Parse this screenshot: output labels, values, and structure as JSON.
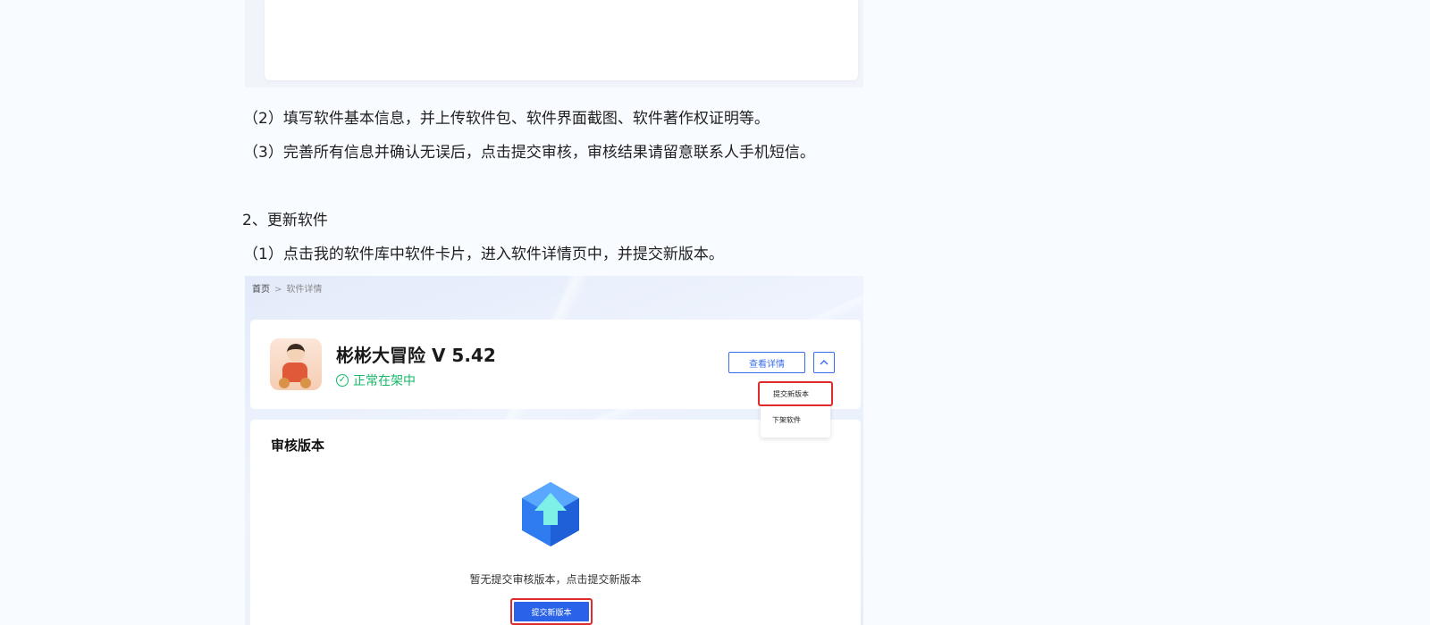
{
  "doc": {
    "step2_line": "（2）填写软件基本信息，并上传软件包、软件界面截图、软件著作权证明等。",
    "step3_line": "（3）完善所有信息并确认无误后，点击提交审核，审核结果请留意联系人手机短信。",
    "section2_heading": "2、更新软件",
    "update_step1_line": "（1）点击我的软件库中软件卡片，进入软件详情页中，并提交新版本。"
  },
  "screenshot": {
    "breadcrumb": {
      "home": "首页",
      "separator": ">",
      "current": "软件详情"
    },
    "app": {
      "name": "彬彬大冒险 V 5.42",
      "status": "正常在架中",
      "status_color": "#14b866"
    },
    "buttons": {
      "view_details": "查看详情",
      "toggle_icon": "chevron-up-icon"
    },
    "dropdown": {
      "items": [
        "提交新版本",
        "下架软件"
      ]
    },
    "audit": {
      "title": "审核版本",
      "empty_text": "暂无提交审核版本，点击提交新版本",
      "submit_button": "提交新版本"
    },
    "colors": {
      "accent": "#2b63e8",
      "highlight": "#e02b2b"
    }
  }
}
